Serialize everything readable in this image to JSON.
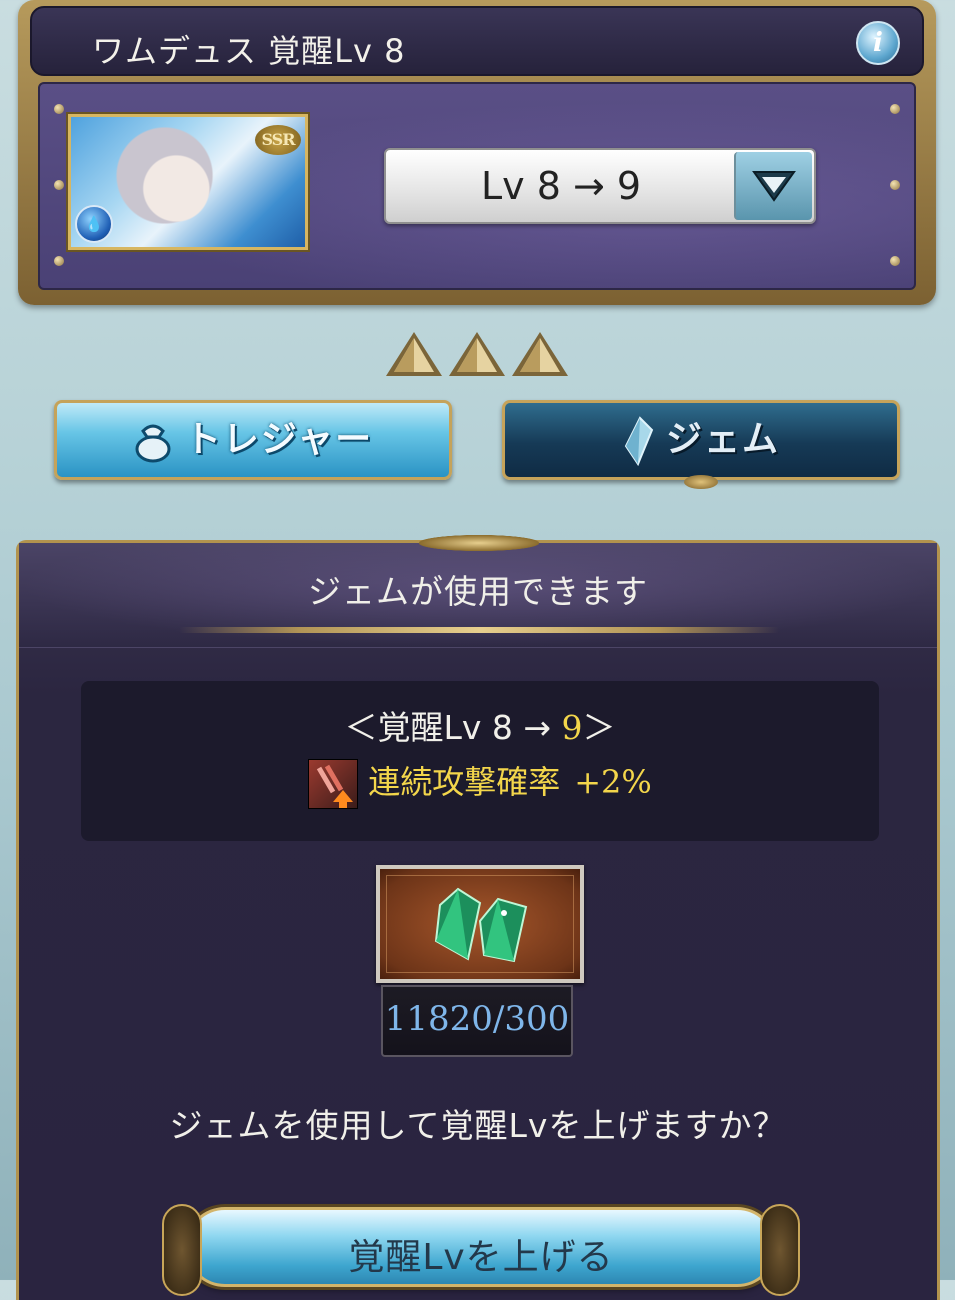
{
  "header": {
    "title": "ワムデュス 覚醒Lv 8",
    "info_icon": "i"
  },
  "character": {
    "rarity_badge": "SSR",
    "element_icon": "water-element-icon"
  },
  "level_select": {
    "value": "Lv 8 → 9"
  },
  "uncap_stars": 3,
  "tabs": [
    {
      "label": "トレジャー",
      "icon": "treasure-bag-icon",
      "selected": false
    },
    {
      "label": "ジェム",
      "icon": "gem-crystal-icon",
      "selected": true
    }
  ],
  "gem_panel": {
    "title": "ジェムが使用できます",
    "bonus": {
      "level_prefix": "＜覚醒Lv 8 → ",
      "level_target": "9",
      "level_suffix": "＞",
      "effect_label": "連続攻撃確率",
      "effect_value": "+2%"
    },
    "gem_count": "11820/300",
    "confirm_question": "ジェムを使用して覚醒Lvを上げますか？",
    "confirm_button": "覚醒Lvを上げる"
  },
  "colors": {
    "panel_purple": "#4a4175",
    "gold_frame": "#b69a5c",
    "highlight_yellow": "#f3d64b",
    "count_blue": "#7fb6ea"
  }
}
